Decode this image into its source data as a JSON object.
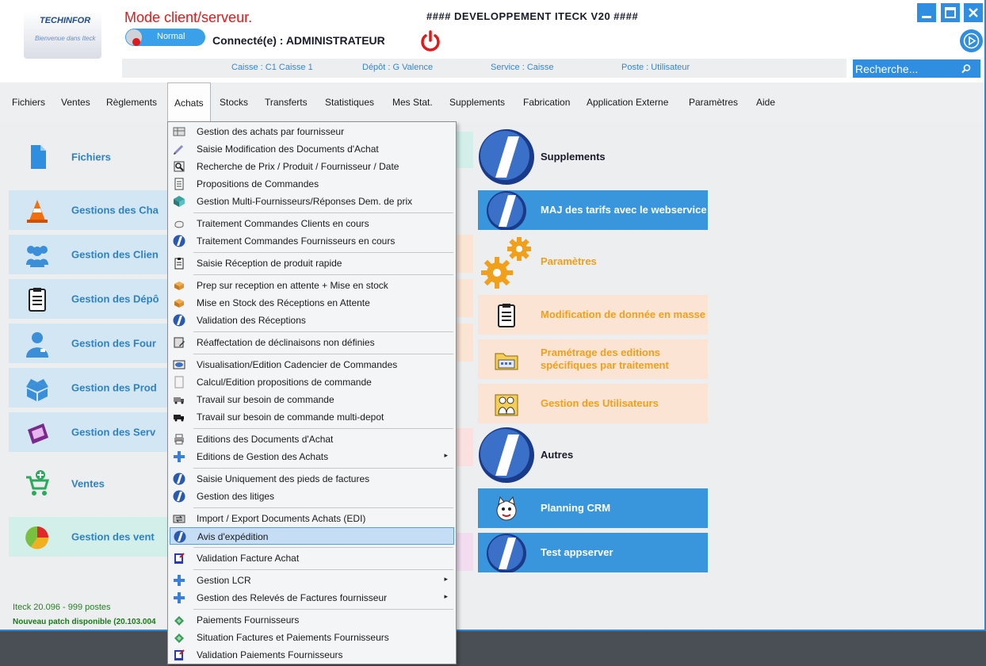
{
  "header": {
    "logo_text": "TECHINFOR",
    "logo_subtitle": "Bienvenue dans Iteck",
    "mode_title": "Mode client/serveur.",
    "toggle_label": "Normal",
    "connected": "Connecté(e) : ADMINISTRATEUR",
    "app_title": "#### DEVELOPPEMENT ITECK V20 ####"
  },
  "info_bar": {
    "caisse": "Caisse : C1 Caisse 1",
    "depot": "Dépôt : G Valence",
    "service": "Service : Caisse",
    "poste": "Poste : Utilisateur"
  },
  "search": {
    "placeholder": "Recherche..."
  },
  "menubar": {
    "items": [
      "Fichiers",
      "Ventes",
      "Règlements",
      "Achats",
      "Stocks",
      "Transferts",
      "Statistiques",
      "Mes Stat.",
      "Supplements",
      "Fabrication",
      "Application Externe",
      "Paramètres",
      "Aide"
    ],
    "active": "Achats"
  },
  "left_tiles": [
    "Fichiers",
    "Gestions des Cha",
    "Gestion des Clien",
    "Gestion des Dépô",
    "Gestion des Four",
    "Gestion des Prod",
    "Gestion des Serv",
    "Ventes",
    "Gestion des vent"
  ],
  "right_tiles": {
    "supplements": "Supplements",
    "maj_tarifs": "MAJ des tarifs avec le webservice",
    "parametres": "Paramètres",
    "modif_masse": "Modification de donnée en masse",
    "parametrage_editions": "Pramétrage des editions spécifiques par traitement",
    "gestion_utilisateurs": "Gestion des Utilisateurs",
    "autres": "Autres",
    "planning_crm": "Planning CRM",
    "test_appserver": "Test appserver"
  },
  "footer": {
    "version": "Iteck 20.096 - 999 postes",
    "patch": "Nouveau patch disponible (20.103.004"
  },
  "dropdown": {
    "items": [
      "Gestion des achats par fournisseur",
      "Saisie Modification des Documents d'Achat",
      "Recherche de Prix / Produit / Fournisseur / Date",
      "Propositions de Commandes",
      "Gestion Multi-Fournisseurs/Réponses Dem. de prix",
      "Traitement Commandes Clients en cours",
      "Traitement Commandes Fournisseurs en cours",
      "Saisie Réception de produit rapide",
      "Prep sur reception en attente + Mise en stock",
      "Mise en Stock des Réceptions en Attente",
      "Validation des Réceptions",
      "Réaffectation de déclinaisons non définies",
      "Visualisation/Edition Cadencier de Commandes",
      "Calcul/Edition propositions de commande",
      "Travail sur besoin de commande",
      "Travail sur besoin de commande multi-depot",
      "Editions des Documents d'Achat",
      "Editions de Gestion des Achats",
      "Saisie Uniquement des pieds de factures",
      "Gestion des litiges",
      "Import / Export Documents Achats (EDI)",
      "Avis d'expédition",
      "Validation Facture Achat",
      "Gestion LCR",
      "Gestion des Relevés de Factures fournisseur",
      "Paiements Fournisseurs",
      "Situation Factures et Paiements Fournisseurs",
      "Validation Paiements Fournisseurs"
    ],
    "selected": "Avis d'expédition",
    "submenu_arrow": "▸"
  },
  "colors": {
    "accent": "#2f8ee0",
    "tile_blue": "#3a96dc",
    "tile_orange_text": "#f0a01a",
    "title_red": "#e01a1a"
  }
}
